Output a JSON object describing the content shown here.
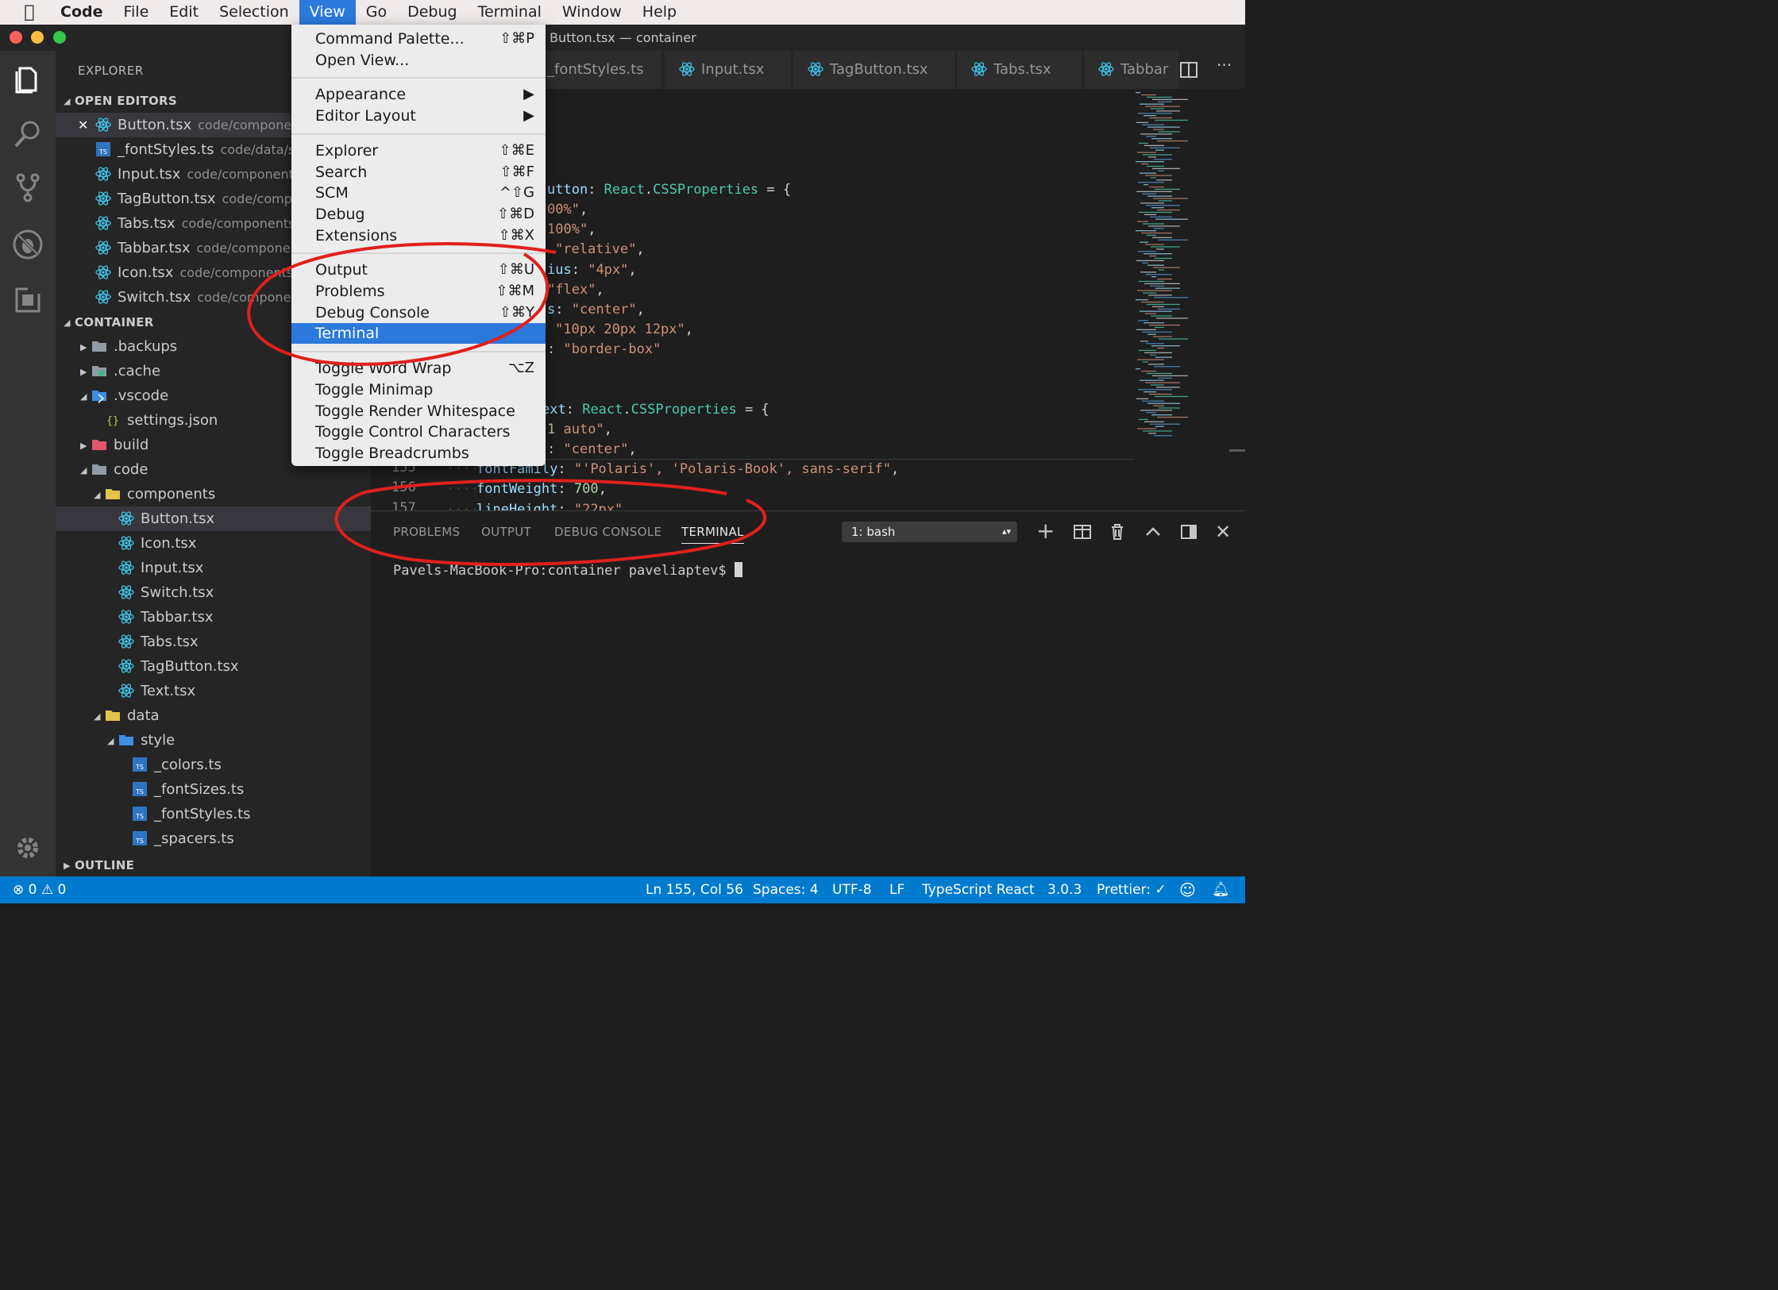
{
  "menubar": {
    "app": "Code",
    "items": [
      "File",
      "Edit",
      "Selection",
      "View",
      "Go",
      "Debug",
      "Terminal",
      "Window",
      "Help"
    ],
    "active": "View"
  },
  "window_title": "Button.tsx — container",
  "explorer": {
    "title": "EXPLORER",
    "open_editors_label": "OPEN EDITORS",
    "open_editors": [
      {
        "name": "Button.tsx",
        "path": "code/componen",
        "kind": "react",
        "active": true
      },
      {
        "name": "_fontStyles.ts",
        "path": "code/data/s",
        "kind": "ts"
      },
      {
        "name": "Input.tsx",
        "path": "code/components",
        "kind": "react"
      },
      {
        "name": "TagButton.tsx",
        "path": "code/comp",
        "kind": "react"
      },
      {
        "name": "Tabs.tsx",
        "path": "code/components",
        "kind": "react"
      },
      {
        "name": "Tabbar.tsx",
        "path": "code/componen",
        "kind": "react"
      },
      {
        "name": "Icon.tsx",
        "path": "code/components",
        "kind": "react"
      },
      {
        "name": "Switch.tsx",
        "path": "code/componen",
        "kind": "react"
      }
    ],
    "container_label": "CONTAINER",
    "tree": [
      {
        "name": ".backups",
        "depth": 1,
        "kind": "folder",
        "arrow": "closed"
      },
      {
        "name": ".cache",
        "depth": 1,
        "kind": "folder-cache",
        "arrow": "closed"
      },
      {
        "name": ".vscode",
        "depth": 1,
        "kind": "folder-vscode",
        "arrow": "open"
      },
      {
        "name": "settings.json",
        "depth": 2,
        "kind": "json",
        "arrow": ""
      },
      {
        "name": "build",
        "depth": 1,
        "kind": "folder-build",
        "arrow": "closed"
      },
      {
        "name": "code",
        "depth": 1,
        "kind": "folder",
        "arrow": "open"
      },
      {
        "name": "components",
        "depth": 2,
        "kind": "folder-open-yellow",
        "arrow": "open"
      },
      {
        "name": "Button.tsx",
        "depth": 3,
        "kind": "react",
        "arrow": "",
        "selected": true
      },
      {
        "name": "Icon.tsx",
        "depth": 3,
        "kind": "react",
        "arrow": ""
      },
      {
        "name": "Input.tsx",
        "depth": 3,
        "kind": "react",
        "arrow": ""
      },
      {
        "name": "Switch.tsx",
        "depth": 3,
        "kind": "react",
        "arrow": ""
      },
      {
        "name": "Tabbar.tsx",
        "depth": 3,
        "kind": "react",
        "arrow": ""
      },
      {
        "name": "Tabs.tsx",
        "depth": 3,
        "kind": "react",
        "arrow": ""
      },
      {
        "name": "TagButton.tsx",
        "depth": 3,
        "kind": "react",
        "arrow": ""
      },
      {
        "name": "Text.tsx",
        "depth": 3,
        "kind": "react",
        "arrow": ""
      },
      {
        "name": "data",
        "depth": 2,
        "kind": "folder-open-yellow",
        "arrow": "open"
      },
      {
        "name": "style",
        "depth": 3,
        "kind": "folder-open-blue",
        "arrow": "open"
      },
      {
        "name": "_colors.ts",
        "depth": 4,
        "kind": "ts",
        "arrow": ""
      },
      {
        "name": "_fontSizes.ts",
        "depth": 4,
        "kind": "ts",
        "arrow": ""
      },
      {
        "name": "_fontStyles.ts",
        "depth": 4,
        "kind": "ts",
        "arrow": ""
      },
      {
        "name": "_spacers.ts",
        "depth": 4,
        "kind": "ts",
        "arrow": ""
      }
    ],
    "outline_label": "OUTLINE"
  },
  "tabs": [
    "_fontStyles.ts",
    "Input.tsx",
    "TagButton.tsx",
    "Tabs.tsx",
    "Tabbar"
  ],
  "code_lines": [
    {
      "ln": "",
      "parts": [
        [
          "#9cdcfe",
          "utton"
        ],
        [
          "#d4d4d4",
          ": "
        ],
        [
          "#4ec9b0",
          "React"
        ],
        [
          "#d4d4d4",
          "."
        ],
        [
          "#4ec9b0",
          "CSSProperties"
        ],
        [
          "#d4d4d4",
          " = {"
        ]
      ]
    },
    {
      "ln": "",
      "parts": [
        [
          "#ce9178",
          "00%\""
        ],
        [
          "#d4d4d4",
          ","
        ]
      ]
    },
    {
      "ln": "",
      "parts": [
        [
          "#ce9178",
          "100%\""
        ],
        [
          "#d4d4d4",
          ","
        ]
      ]
    },
    {
      "ln": "",
      "parts": [
        [
          "#ce9178",
          "\"relative\""
        ],
        [
          "#d4d4d4",
          ","
        ]
      ]
    },
    {
      "ln": "",
      "parts": [
        [
          "#9cdcfe",
          "ius"
        ],
        [
          "#d4d4d4",
          ": "
        ],
        [
          "#ce9178",
          "\"4px\""
        ],
        [
          "#d4d4d4",
          ","
        ]
      ]
    },
    {
      "ln": "",
      "parts": [
        [
          "#ce9178",
          "\"flex\""
        ],
        [
          "#d4d4d4",
          ","
        ]
      ]
    },
    {
      "ln": "",
      "parts": [
        [
          "#9cdcfe",
          "s"
        ],
        [
          "#d4d4d4",
          ": "
        ],
        [
          "#ce9178",
          "\"center\""
        ],
        [
          "#d4d4d4",
          ","
        ]
      ]
    },
    {
      "ln": "",
      "parts": [
        [
          "#ce9178",
          "\"10px 20px 12px\""
        ],
        [
          "#d4d4d4",
          ","
        ]
      ]
    },
    {
      "ln": "",
      "parts": [
        [
          "#d4d4d4",
          ": "
        ],
        [
          "#ce9178",
          "\"border-box\""
        ]
      ]
    },
    {
      "ln": "",
      "parts": []
    },
    {
      "ln": "",
      "parts": []
    },
    {
      "ln": "",
      "parts": [
        [
          "#9cdcfe",
          "ext"
        ],
        [
          "#d4d4d4",
          ": "
        ],
        [
          "#4ec9b0",
          "React"
        ],
        [
          "#d4d4d4",
          "."
        ],
        [
          "#4ec9b0",
          "CSSProperties"
        ],
        [
          "#d4d4d4",
          " = {"
        ]
      ]
    },
    {
      "ln": "",
      "parts": [
        [
          "#b5cea8",
          "1"
        ],
        [
          "#ce9178",
          " auto\""
        ],
        [
          "#d4d4d4",
          ","
        ]
      ]
    },
    {
      "ln": "",
      "parts": [
        [
          "#d4d4d4",
          ": "
        ],
        [
          "#ce9178",
          "\"center\""
        ],
        [
          "#d4d4d4",
          ","
        ]
      ]
    },
    {
      "ln": "155",
      "parts": [
        [
          "#9cdcfe",
          "fontFamily"
        ],
        [
          "#d4d4d4",
          ": "
        ],
        [
          "#ce9178",
          "\"'Polaris', 'Polaris-Book', sans-serif\""
        ],
        [
          "#d4d4d4",
          ","
        ]
      ]
    },
    {
      "ln": "156",
      "parts": [
        [
          "#9cdcfe",
          "fontWeight"
        ],
        [
          "#d4d4d4",
          ": "
        ],
        [
          "#b5cea8",
          "700"
        ],
        [
          "#d4d4d4",
          ","
        ]
      ]
    },
    {
      "ln": "157",
      "parts": [
        [
          "#9cdcfe",
          "lineHeight"
        ],
        [
          "#d4d4d4",
          ": "
        ],
        [
          "#ce9178",
          "\"22px\""
        ]
      ]
    }
  ],
  "view_menu": [
    {
      "label": "Command Palette...",
      "shortcut": "⇧⌘P"
    },
    {
      "label": "Open View...",
      "shortcut": ""
    },
    {
      "sep": true
    },
    {
      "label": "Appearance",
      "shortcut": "▶"
    },
    {
      "label": "Editor Layout",
      "shortcut": "▶"
    },
    {
      "sep": true
    },
    {
      "label": "Explorer",
      "shortcut": "⇧⌘E"
    },
    {
      "label": "Search",
      "shortcut": "⇧⌘F"
    },
    {
      "label": "SCM",
      "shortcut": "^⇧G"
    },
    {
      "label": "Debug",
      "shortcut": "⇧⌘D"
    },
    {
      "label": "Extensions",
      "shortcut": "⇧⌘X"
    },
    {
      "sep": true
    },
    {
      "label": "Output",
      "shortcut": "⇧⌘U"
    },
    {
      "label": "Problems",
      "shortcut": "⇧⌘M"
    },
    {
      "label": "Debug Console",
      "shortcut": "⇧⌘Y"
    },
    {
      "label": "Terminal",
      "shortcut": "",
      "selected": true
    },
    {
      "sep": true
    },
    {
      "label": "Toggle Word Wrap",
      "shortcut": "⌥Z"
    },
    {
      "label": "Toggle Minimap",
      "shortcut": ""
    },
    {
      "label": "Toggle Render Whitespace",
      "shortcut": ""
    },
    {
      "label": "Toggle Control Characters",
      "shortcut": ""
    },
    {
      "label": "Toggle Breadcrumbs",
      "shortcut": ""
    }
  ],
  "panel": {
    "tabs": [
      "PROBLEMS",
      "OUTPUT",
      "DEBUG CONSOLE",
      "TERMINAL"
    ],
    "active_tab": "TERMINAL",
    "terminal_select": "1: bash",
    "prompt": "Pavels-MacBook-Pro:container paveliaptev$"
  },
  "status": {
    "errors": "0",
    "warnings": "0",
    "position": "Ln 155, Col 56",
    "spaces": "Spaces: 4",
    "encoding": "UTF-8",
    "eol": "LF",
    "language": "TypeScript React",
    "version": "3.0.3",
    "prettier": "Prettier: ✓"
  },
  "colors": {
    "accent": "#007acc",
    "menu_highlight": "#2c79dc",
    "react_icon": "#3fc3e8",
    "annotation": "#e0201c"
  }
}
